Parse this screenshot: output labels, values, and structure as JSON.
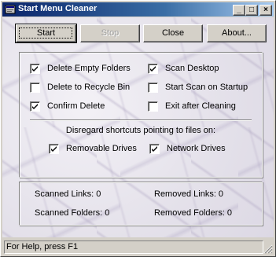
{
  "window": {
    "title": "Start Menu Cleaner",
    "controls": {
      "minimize": "_",
      "maximize": "□",
      "close": "×"
    }
  },
  "buttons": {
    "start": "Start",
    "stop": "Stop",
    "close": "Close",
    "about": "About..."
  },
  "options": {
    "delete_empty_folders": {
      "label": "Delete Empty Folders",
      "checked": true
    },
    "delete_to_recycle_bin": {
      "label": "Delete to Recycle Bin",
      "checked": false
    },
    "confirm_delete": {
      "label": "Confirm Delete",
      "checked": true
    },
    "scan_desktop": {
      "label": "Scan Desktop",
      "checked": true
    },
    "start_scan_on_startup": {
      "label": "Start Scan on Startup",
      "checked": false
    },
    "exit_after_cleaning": {
      "label": "Exit after Cleaning",
      "checked": false
    }
  },
  "disregard": {
    "heading": "Disregard shortcuts pointing to files on:",
    "removable_drives": {
      "label": "Removable Drives",
      "checked": true
    },
    "network_drives": {
      "label": "Network Drives",
      "checked": true
    }
  },
  "stats": {
    "scanned_links": "Scanned Links: 0",
    "removed_links": "Removed Links: 0",
    "scanned_folders": "Scanned Folders: 0",
    "removed_folders": "Removed Folders: 0"
  },
  "statusbar": {
    "text": "For Help, press F1"
  },
  "icons": {
    "app": "broom-window-icon",
    "check": "checkmark-icon",
    "grip": "resize-grip-icon"
  }
}
